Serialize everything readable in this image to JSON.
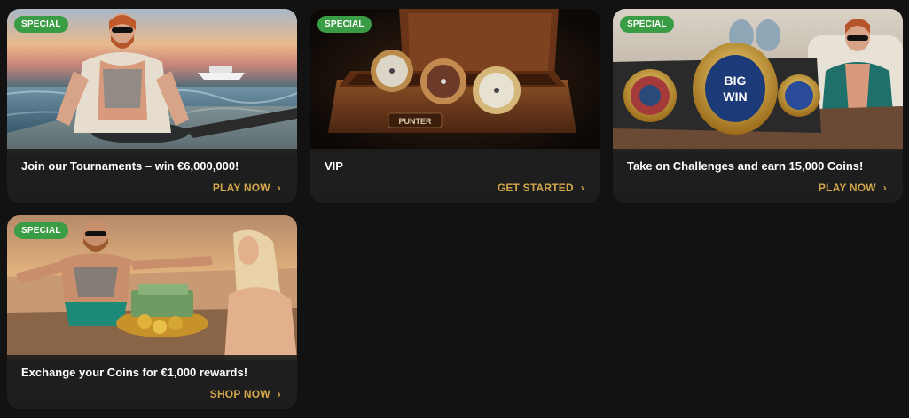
{
  "promotions": [
    {
      "badge": "SPECIAL",
      "title": "Join our Tournaments – win €6,000,000!",
      "cta": "PLAY NOW",
      "image": "man-on-speedboat"
    },
    {
      "badge": "",
      "title": "VIP",
      "cta": "GET STARTED",
      "image": "watch-box",
      "box_label": "PUNTER"
    },
    {
      "badge": "SPECIAL",
      "title": "Take on Challenges and earn 15,000 Coins!",
      "cta": "PLAY NOW",
      "image": "championship-belt",
      "belt_text_1": "BIG",
      "belt_text_2": "WIN"
    },
    {
      "badge": "SPECIAL",
      "title": "Exchange your Coins for €1,000 rewards!",
      "cta": "SHOP NOW",
      "image": "man-with-cash-tray"
    }
  ],
  "colors": {
    "page_bg": "#121212",
    "card_bg": "#1f1f1f",
    "cta": "#d2a64b",
    "badge": "#3a9c44"
  },
  "icons": {
    "chevron": "chevron-right-icon"
  }
}
